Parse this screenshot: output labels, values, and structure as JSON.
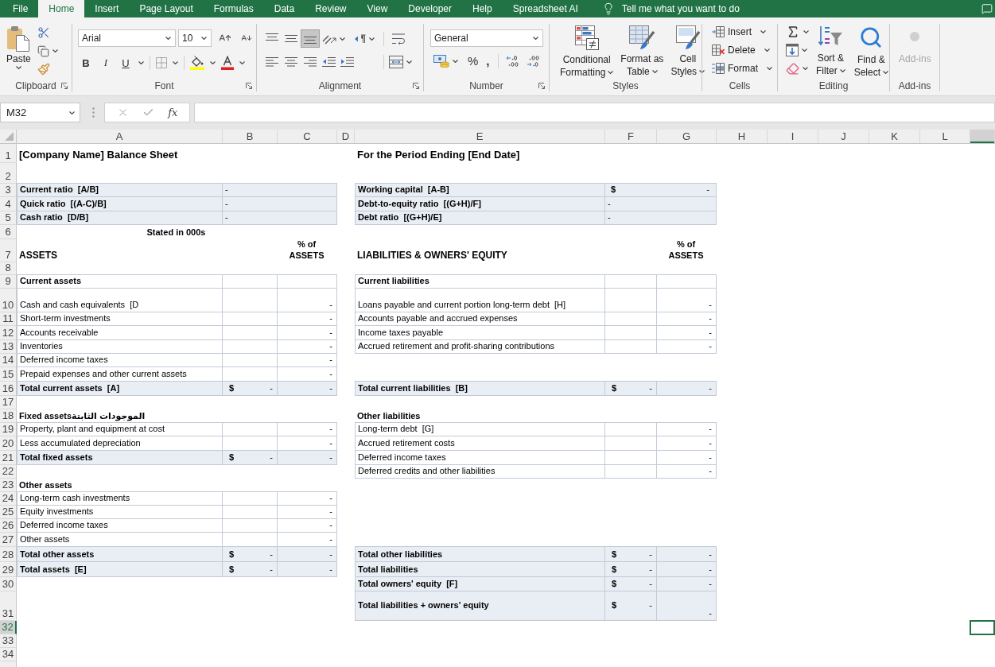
{
  "menu_tabs": [
    {
      "label": "File",
      "selected": false
    },
    {
      "label": "Home",
      "selected": true
    },
    {
      "label": "Insert",
      "selected": false
    },
    {
      "label": "Page Layout",
      "selected": false
    },
    {
      "label": "Formulas",
      "selected": false
    },
    {
      "label": "Data",
      "selected": false
    },
    {
      "label": "Review",
      "selected": false
    },
    {
      "label": "View",
      "selected": false
    },
    {
      "label": "Developer",
      "selected": false
    },
    {
      "label": "Help",
      "selected": false
    },
    {
      "label": "Spreadsheet AI",
      "selected": false
    }
  ],
  "tell_me": {
    "placeholder": "Tell me what you want to do"
  },
  "ribbon": {
    "clipboard": {
      "label": "Clipboard",
      "paste": "Paste"
    },
    "font": {
      "label": "Font",
      "font_name": "Arial",
      "font_size": "10",
      "bold": "B",
      "italic": "I",
      "underline": "U"
    },
    "alignment": {
      "label": "Alignment",
      "vertical_align": [
        {
          "selected": false
        },
        {
          "selected": false
        },
        {
          "selected": true
        }
      ]
    },
    "number": {
      "label": "Number",
      "format": "General",
      "percent": "%",
      "comma": ","
    },
    "styles": {
      "label": "Styles",
      "buttons": [
        {
          "lines": [
            "Conditional",
            "Formatting"
          ]
        },
        {
          "lines": [
            "Format as",
            "Table"
          ]
        },
        {
          "lines": [
            "Cell",
            "Styles"
          ]
        }
      ]
    },
    "cells": {
      "label": "Cells",
      "buttons": [
        "Insert",
        "Delete",
        "Format"
      ]
    },
    "editing": {
      "label": "Editing",
      "buttons": [
        {
          "lines": [
            "Sort &",
            "Filter"
          ]
        },
        {
          "lines": [
            "Find &",
            "Select"
          ]
        }
      ]
    },
    "addins": {
      "label": "Add-ins",
      "button": "Add-ins",
      "disabled": true
    }
  },
  "formula_bar": {
    "name_box": "M32",
    "insert_function": "fx"
  },
  "sheet": {
    "columns": [
      "A",
      "B",
      "C",
      "D",
      "E",
      "F",
      "G",
      "H",
      "I",
      "J",
      "K",
      "L"
    ],
    "rows": [
      {
        "header": "1",
        "selected": false,
        "left": {
          "kind": "title",
          "label": "[Company Name] Balance Sheet"
        },
        "right": {
          "kind": "title",
          "label": "For the Period Ending [End Date]"
        }
      },
      {
        "header": "2",
        "selected": false
      },
      {
        "header": "3",
        "selected": false,
        "left": {
          "kind": "ratio",
          "label": "Current ratio  [A/B]",
          "value": "-"
        },
        "right": {
          "kind": "ratio",
          "label": "Working capital  [A-B]",
          "currency": "$",
          "value": "-"
        }
      },
      {
        "header": "4",
        "selected": false,
        "left": {
          "kind": "ratio",
          "label": "Quick ratio  [(A-C)/B]",
          "value": "-"
        },
        "right": {
          "kind": "ratio",
          "label": "Debt-to-equity ratio  [(G+H)/F]",
          "value": "-"
        }
      },
      {
        "header": "5",
        "selected": false,
        "left": {
          "kind": "ratio",
          "label": "Cash ratio  [D/B]",
          "value": "-"
        },
        "right": {
          "kind": "ratio",
          "label": "Debt ratio  [(G+H)/E]",
          "value": "-"
        }
      },
      {
        "header": "6",
        "selected": false,
        "left": {
          "kind": "note",
          "label": "Stated in 000s"
        }
      },
      {
        "header": "7",
        "selected": false,
        "left": {
          "kind": "heading",
          "label": "ASSETS",
          "percent_header": "% of ASSETS"
        },
        "right": {
          "kind": "heading",
          "label": "LIABILITIES & OWNERS' EQUITY",
          "percent_header": "% of ASSETS"
        }
      },
      {
        "header": "8",
        "selected": false
      },
      {
        "header": "9",
        "selected": false,
        "left": {
          "kind": "section_boxed",
          "label": "Current assets"
        },
        "right": {
          "kind": "section_boxed",
          "label": "Current liabilities"
        }
      },
      {
        "header": "10",
        "selected": false,
        "left": {
          "kind": "item",
          "label": "Cash and cash equivalents  [D",
          "percent": "-"
        },
        "right": {
          "kind": "item",
          "label": "Loans payable and current portion long-term debt  [H]",
          "percent": "-"
        }
      },
      {
        "header": "11",
        "selected": false,
        "left": {
          "kind": "item",
          "label": "Short-term investments",
          "percent": "-"
        },
        "right": {
          "kind": "item",
          "label": "Accounts payable and accrued expenses",
          "percent": "-"
        }
      },
      {
        "header": "12",
        "selected": false,
        "left": {
          "kind": "item",
          "label": "Accounts receivable",
          "percent": "-"
        },
        "right": {
          "kind": "item",
          "label": "Income taxes payable",
          "percent": "-"
        }
      },
      {
        "header": "13",
        "selected": false,
        "left": {
          "kind": "item",
          "label": "Inventories",
          "percent": "-"
        },
        "right": {
          "kind": "item",
          "label": "Accrued retirement and profit-sharing contributions",
          "percent": "-"
        }
      },
      {
        "header": "14",
        "selected": false,
        "left": {
          "kind": "item",
          "label": "Deferred income taxes",
          "percent": "-"
        }
      },
      {
        "header": "15",
        "selected": false,
        "left": {
          "kind": "item",
          "label": "Prepaid expenses and other current assets",
          "percent": "-"
        }
      },
      {
        "header": "16",
        "selected": false,
        "left": {
          "kind": "total",
          "label": "Total current assets  [A]",
          "currency": "$",
          "amount": "-",
          "percent": "-"
        },
        "right": {
          "kind": "total",
          "label": "Total current liabilities  [B]",
          "currency": "$",
          "amount": "-",
          "percent": "-"
        }
      },
      {
        "header": "17",
        "selected": false
      },
      {
        "header": "18",
        "selected": false,
        "left": {
          "kind": "section",
          "label": "Fixed assetsالموجودات الثابتة"
        },
        "right": {
          "kind": "section",
          "label": "Other liabilities"
        }
      },
      {
        "header": "19",
        "selected": false,
        "left": {
          "kind": "item",
          "label": "Property, plant and equipment at cost",
          "percent": "-"
        },
        "right": {
          "kind": "item",
          "label": "Long-term debt  [G]",
          "percent": "-"
        }
      },
      {
        "header": "20",
        "selected": false,
        "left": {
          "kind": "item",
          "label": "Less accumulated depreciation",
          "percent": "-"
        },
        "right": {
          "kind": "item",
          "label": "Accrued retirement costs",
          "percent": "-"
        }
      },
      {
        "header": "21",
        "selected": false,
        "left": {
          "kind": "total",
          "label": "Total fixed assets",
          "currency": "$",
          "amount": "-",
          "percent": "-"
        },
        "right": {
          "kind": "item",
          "label": "Deferred income taxes",
          "percent": "-"
        }
      },
      {
        "header": "22",
        "selected": false,
        "right": {
          "kind": "item",
          "label": "Deferred credits and other liabilities",
          "percent": "-"
        }
      },
      {
        "header": "23",
        "selected": false,
        "left": {
          "kind": "section",
          "label": "Other assets"
        }
      },
      {
        "header": "24",
        "selected": false,
        "left": {
          "kind": "item",
          "label": "Long-term cash investments",
          "percent": "-"
        }
      },
      {
        "header": "25",
        "selected": false,
        "left": {
          "kind": "item",
          "label": "Equity investments",
          "percent": "-"
        }
      },
      {
        "header": "26",
        "selected": false,
        "left": {
          "kind": "item",
          "label": "Deferred income taxes",
          "percent": "-"
        }
      },
      {
        "header": "27",
        "selected": false,
        "left": {
          "kind": "item",
          "label": "Other assets",
          "percent": "-"
        }
      },
      {
        "header": "28",
        "selected": false,
        "left": {
          "kind": "total",
          "label": "Total other assets",
          "currency": "$",
          "amount": "-",
          "percent": "-"
        },
        "right": {
          "kind": "total",
          "label": "Total other liabilities",
          "currency": "$",
          "amount": "-",
          "percent": "-"
        }
      },
      {
        "header": "29",
        "selected": false,
        "left": {
          "kind": "total",
          "label": "Total assets  [E]",
          "currency": "$",
          "amount": "-",
          "percent": "-"
        },
        "right": {
          "kind": "total",
          "label": "Total liabilities",
          "currency": "$",
          "amount": "-",
          "percent": "-"
        }
      },
      {
        "header": "30",
        "selected": false,
        "right": {
          "kind": "total",
          "label": "Total owners' equity  [F]",
          "currency": "$",
          "amount": "-",
          "percent": "-"
        }
      },
      {
        "header": "31",
        "selected": false,
        "right": {
          "kind": "grand_total",
          "label": "Total liabilities + owners' equity",
          "currency": "$",
          "amount": "-",
          "percent": "-"
        }
      },
      {
        "header": "32",
        "selected": true
      },
      {
        "header": "33",
        "selected": false
      },
      {
        "header": "34",
        "selected": false
      }
    ]
  }
}
